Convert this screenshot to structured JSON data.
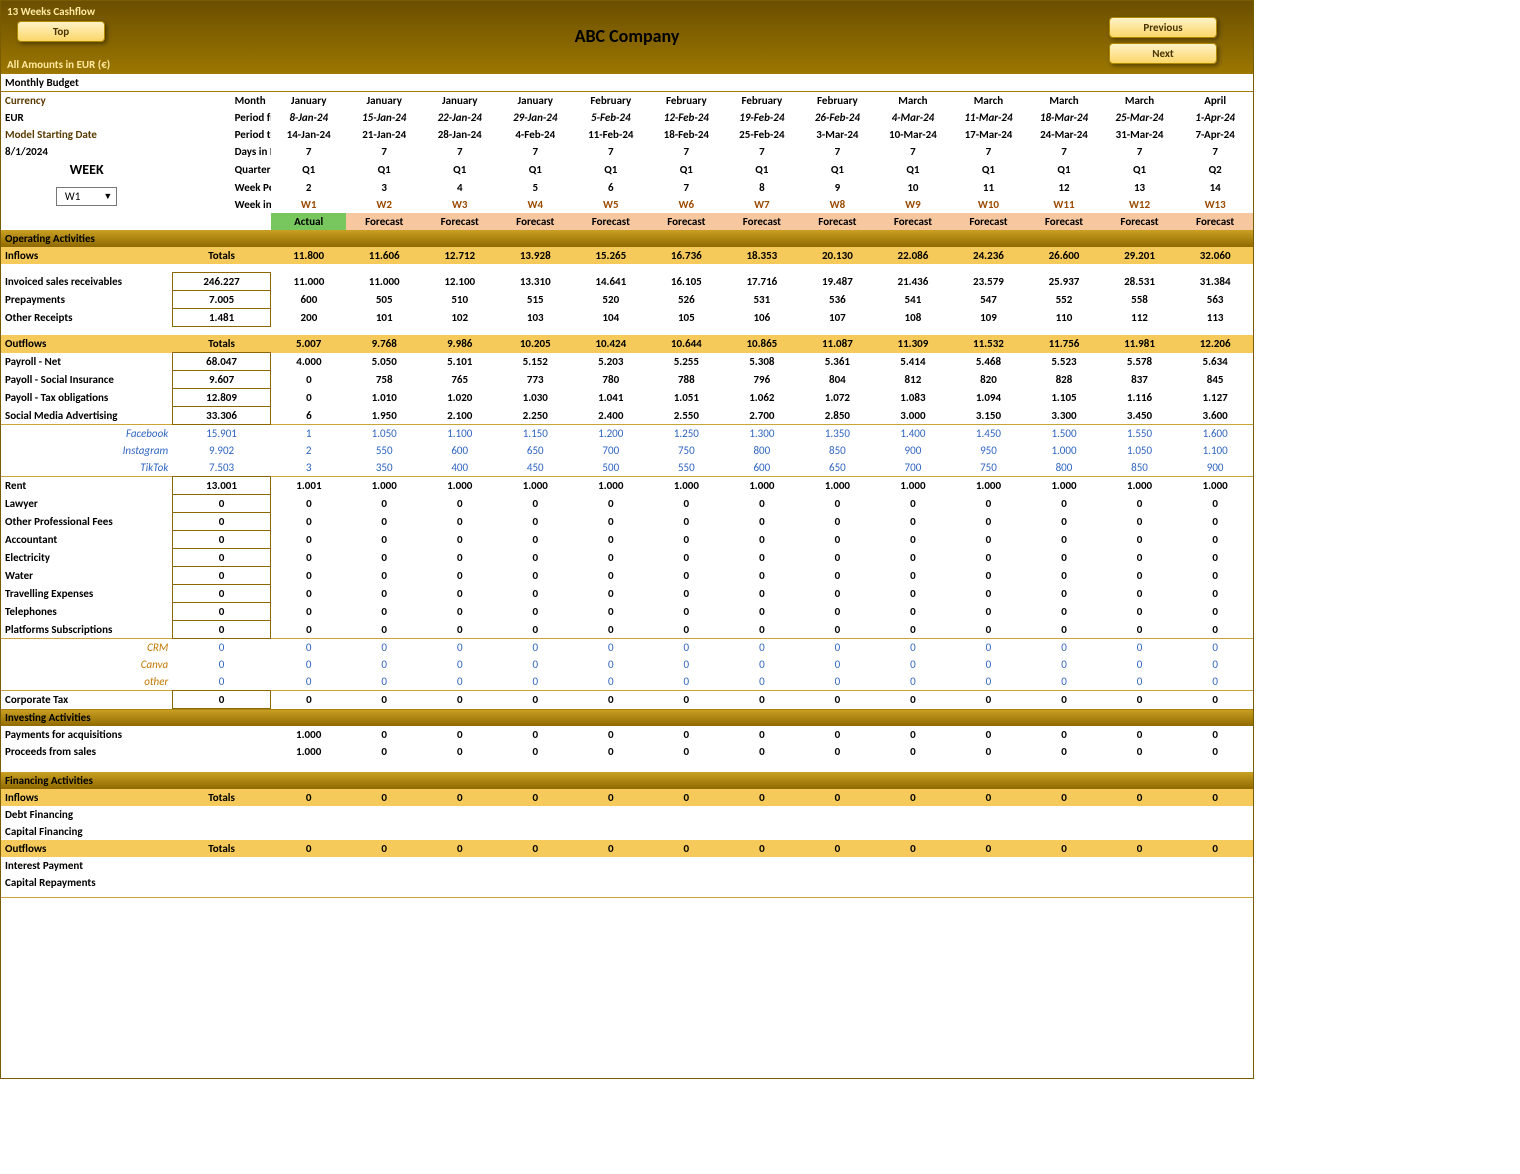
{
  "top": {
    "title": "13 Weeks Cashflow",
    "btnTop": "Top",
    "btnPrev": "Previous",
    "btnNext": "Next",
    "company": "ABC Company",
    "amtNote": "All Amounts in  EUR (€)"
  },
  "left": {
    "monthly": "Monthly Budget",
    "currency": "Currency",
    "eur": "EUR",
    "msd": "Model Starting Date",
    "msdVal": "8/1/2024",
    "week": "WEEK",
    "weekSel": "W1"
  },
  "rowLabels": {
    "month": "Month",
    "pfrom": "Period from",
    "pto": "Period to",
    "dip": "Days in Perio",
    "qtr": "Quarter",
    "wperiod": "Week Perio",
    "wmodel": "Week in Mo"
  },
  "cols": [
    {
      "month": "January",
      "pfrom": "8-Jan-24",
      "pto": "14-Jan-24",
      "days": "7",
      "qtr": "Q1",
      "wp": "2",
      "wm": "W1",
      "af": "Actual"
    },
    {
      "month": "January",
      "pfrom": "15-Jan-24",
      "pto": "21-Jan-24",
      "days": "7",
      "qtr": "Q1",
      "wp": "3",
      "wm": "W2",
      "af": "Forecast"
    },
    {
      "month": "January",
      "pfrom": "22-Jan-24",
      "pto": "28-Jan-24",
      "days": "7",
      "qtr": "Q1",
      "wp": "4",
      "wm": "W3",
      "af": "Forecast"
    },
    {
      "month": "January",
      "pfrom": "29-Jan-24",
      "pto": "4-Feb-24",
      "days": "7",
      "qtr": "Q1",
      "wp": "5",
      "wm": "W4",
      "af": "Forecast"
    },
    {
      "month": "February",
      "pfrom": "5-Feb-24",
      "pto": "11-Feb-24",
      "days": "7",
      "qtr": "Q1",
      "wp": "6",
      "wm": "W5",
      "af": "Forecast"
    },
    {
      "month": "February",
      "pfrom": "12-Feb-24",
      "pto": "18-Feb-24",
      "days": "7",
      "qtr": "Q1",
      "wp": "7",
      "wm": "W6",
      "af": "Forecast"
    },
    {
      "month": "February",
      "pfrom": "19-Feb-24",
      "pto": "25-Feb-24",
      "days": "7",
      "qtr": "Q1",
      "wp": "8",
      "wm": "W7",
      "af": "Forecast"
    },
    {
      "month": "February",
      "pfrom": "26-Feb-24",
      "pto": "3-Mar-24",
      "days": "7",
      "qtr": "Q1",
      "wp": "9",
      "wm": "W8",
      "af": "Forecast"
    },
    {
      "month": "March",
      "pfrom": "4-Mar-24",
      "pto": "10-Mar-24",
      "days": "7",
      "qtr": "Q1",
      "wp": "10",
      "wm": "W9",
      "af": "Forecast"
    },
    {
      "month": "March",
      "pfrom": "11-Mar-24",
      "pto": "17-Mar-24",
      "days": "7",
      "qtr": "Q1",
      "wp": "11",
      "wm": "W10",
      "af": "Forecast"
    },
    {
      "month": "March",
      "pfrom": "18-Mar-24",
      "pto": "24-Mar-24",
      "days": "7",
      "qtr": "Q1",
      "wp": "12",
      "wm": "W11",
      "af": "Forecast"
    },
    {
      "month": "March",
      "pfrom": "25-Mar-24",
      "pto": "31-Mar-24",
      "days": "7",
      "qtr": "Q1",
      "wp": "13",
      "wm": "W12",
      "af": "Forecast"
    },
    {
      "month": "April",
      "pfrom": "1-Apr-24",
      "pto": "7-Apr-24",
      "days": "7",
      "qtr": "Q2",
      "wp": "14",
      "wm": "W13",
      "af": "Forecast"
    }
  ],
  "sec": {
    "op": "Operating  Activities",
    "inflows": "Inflows",
    "outflows": "Outflows",
    "inv": "Investing Activities",
    "fin": "Financing Activities",
    "totals": "Totals"
  },
  "rows": {
    "inflows": {
      "tot": "",
      "v": [
        "11.800",
        "11.606",
        "12.712",
        "13.928",
        "15.265",
        "16.736",
        "18.353",
        "20.130",
        "22.086",
        "24.236",
        "26.600",
        "29.201",
        "32.060"
      ]
    },
    "invoiced": {
      "label": "Invoiced sales receivables",
      "tot": "246.227",
      "v": [
        "11.000",
        "11.000",
        "12.100",
        "13.310",
        "14.641",
        "16.105",
        "17.716",
        "19.487",
        "21.436",
        "23.579",
        "25.937",
        "28.531",
        "31.384"
      ]
    },
    "prepay": {
      "label": "Prepayments",
      "tot": "7.005",
      "v": [
        "600",
        "505",
        "510",
        "515",
        "520",
        "526",
        "531",
        "536",
        "541",
        "547",
        "552",
        "558",
        "563"
      ]
    },
    "other": {
      "label": "Other Receipts",
      "tot": "1.481",
      "v": [
        "200",
        "101",
        "102",
        "103",
        "104",
        "105",
        "106",
        "107",
        "108",
        "109",
        "110",
        "112",
        "113"
      ]
    },
    "outflows": {
      "tot": "",
      "v": [
        "5.007",
        "9.768",
        "9.986",
        "10.205",
        "10.424",
        "10.644",
        "10.865",
        "11.087",
        "11.309",
        "11.532",
        "11.756",
        "11.981",
        "12.206"
      ]
    },
    "payroll": {
      "label": "Payroll - Net",
      "tot": "68.047",
      "v": [
        "4.000",
        "5.050",
        "5.101",
        "5.152",
        "5.203",
        "5.255",
        "5.308",
        "5.361",
        "5.414",
        "5.468",
        "5.523",
        "5.578",
        "5.634"
      ]
    },
    "psoc": {
      "label": "Payoll - Social Insurance",
      "tot": "9.607",
      "v": [
        "0",
        "758",
        "765",
        "773",
        "780",
        "788",
        "796",
        "804",
        "812",
        "820",
        "828",
        "837",
        "845"
      ]
    },
    "ptax": {
      "label": "Payoll - Tax obligations",
      "tot": "12.809",
      "v": [
        "0",
        "1.010",
        "1.020",
        "1.030",
        "1.041",
        "1.051",
        "1.062",
        "1.072",
        "1.083",
        "1.094",
        "1.105",
        "1.116",
        "1.127"
      ]
    },
    "sma": {
      "label": "Social Media Advertising",
      "tot": "33.306",
      "v": [
        "6",
        "1.950",
        "2.100",
        "2.250",
        "2.400",
        "2.550",
        "2.700",
        "2.850",
        "3.000",
        "3.150",
        "3.300",
        "3.450",
        "3.600"
      ]
    },
    "fb": {
      "label": "Facebook",
      "tot": "15.901",
      "v": [
        "1",
        "1.050",
        "1.100",
        "1.150",
        "1.200",
        "1.250",
        "1.300",
        "1.350",
        "1.400",
        "1.450",
        "1.500",
        "1.550",
        "1.600"
      ]
    },
    "ig": {
      "label": "Instagram",
      "tot": "9.902",
      "v": [
        "2",
        "550",
        "600",
        "650",
        "700",
        "750",
        "800",
        "850",
        "900",
        "950",
        "1.000",
        "1.050",
        "1.100"
      ]
    },
    "tt": {
      "label": "TikTok",
      "tot": "7.503",
      "v": [
        "3",
        "350",
        "400",
        "450",
        "500",
        "550",
        "600",
        "650",
        "700",
        "750",
        "800",
        "850",
        "900"
      ]
    },
    "rent": {
      "label": "Rent",
      "tot": "13.001",
      "v": [
        "1.001",
        "1.000",
        "1.000",
        "1.000",
        "1.000",
        "1.000",
        "1.000",
        "1.000",
        "1.000",
        "1.000",
        "1.000",
        "1.000",
        "1.000"
      ]
    },
    "lawyer": {
      "label": "Lawyer",
      "tot": "0",
      "v": [
        "0",
        "0",
        "0",
        "0",
        "0",
        "0",
        "0",
        "0",
        "0",
        "0",
        "0",
        "0",
        "0"
      ]
    },
    "opf": {
      "label": "Other Professional Fees",
      "tot": "0",
      "v": [
        "0",
        "0",
        "0",
        "0",
        "0",
        "0",
        "0",
        "0",
        "0",
        "0",
        "0",
        "0",
        "0"
      ]
    },
    "acct": {
      "label": "Accountant",
      "tot": "0",
      "v": [
        "0",
        "0",
        "0",
        "0",
        "0",
        "0",
        "0",
        "0",
        "0",
        "0",
        "0",
        "0",
        "0"
      ]
    },
    "elec": {
      "label": "Electricity",
      "tot": "0",
      "v": [
        "0",
        "0",
        "0",
        "0",
        "0",
        "0",
        "0",
        "0",
        "0",
        "0",
        "0",
        "0",
        "0"
      ]
    },
    "water": {
      "label": "Water",
      "tot": "0",
      "v": [
        "0",
        "0",
        "0",
        "0",
        "0",
        "0",
        "0",
        "0",
        "0",
        "0",
        "0",
        "0",
        "0"
      ]
    },
    "travel": {
      "label": "Travelling Expenses",
      "tot": "0",
      "v": [
        "0",
        "0",
        "0",
        "0",
        "0",
        "0",
        "0",
        "0",
        "0",
        "0",
        "0",
        "0",
        "0"
      ]
    },
    "tel": {
      "label": "Telephones",
      "tot": "0",
      "v": [
        "0",
        "0",
        "0",
        "0",
        "0",
        "0",
        "0",
        "0",
        "0",
        "0",
        "0",
        "0",
        "0"
      ]
    },
    "plat": {
      "label": "Platforms Subscriptions",
      "tot": "0",
      "v": [
        "0",
        "0",
        "0",
        "0",
        "0",
        "0",
        "0",
        "0",
        "0",
        "0",
        "0",
        "0",
        "0"
      ]
    },
    "crm": {
      "label": "CRM",
      "tot": "0",
      "v": [
        "0",
        "0",
        "0",
        "0",
        "0",
        "0",
        "0",
        "0",
        "0",
        "0",
        "0",
        "0",
        "0"
      ]
    },
    "canva": {
      "label": "Canva",
      "tot": "0",
      "v": [
        "0",
        "0",
        "0",
        "0",
        "0",
        "0",
        "0",
        "0",
        "0",
        "0",
        "0",
        "0",
        "0"
      ]
    },
    "oth": {
      "label": "other",
      "tot": "0",
      "v": [
        "0",
        "0",
        "0",
        "0",
        "0",
        "0",
        "0",
        "0",
        "0",
        "0",
        "0",
        "0",
        "0"
      ]
    },
    "ctax": {
      "label": "Corporate Tax",
      "tot": "0",
      "v": [
        "0",
        "0",
        "0",
        "0",
        "0",
        "0",
        "0",
        "0",
        "0",
        "0",
        "0",
        "0",
        "0"
      ]
    },
    "pacq": {
      "label": "Payments for acquisitions",
      "v": [
        "1.000",
        "0",
        "0",
        "0",
        "0",
        "0",
        "0",
        "0",
        "0",
        "0",
        "0",
        "0",
        "0"
      ]
    },
    "psale": {
      "label": "Proceeds from sales",
      "v": [
        "1.000",
        "0",
        "0",
        "0",
        "0",
        "0",
        "0",
        "0",
        "0",
        "0",
        "0",
        "0",
        "0"
      ]
    },
    "finfl": {
      "v": [
        "0",
        "0",
        "0",
        "0",
        "0",
        "0",
        "0",
        "0",
        "0",
        "0",
        "0",
        "0",
        "0"
      ]
    },
    "debt": {
      "label": "Debt Financing"
    },
    "cap": {
      "label": "Capital Financing"
    },
    "fout": {
      "v": [
        "0",
        "0",
        "0",
        "0",
        "0",
        "0",
        "0",
        "0",
        "0",
        "0",
        "0",
        "0",
        "0"
      ]
    },
    "int": {
      "label": "Interest Payment"
    },
    "rep": {
      "label": "Capital Repayments"
    }
  }
}
